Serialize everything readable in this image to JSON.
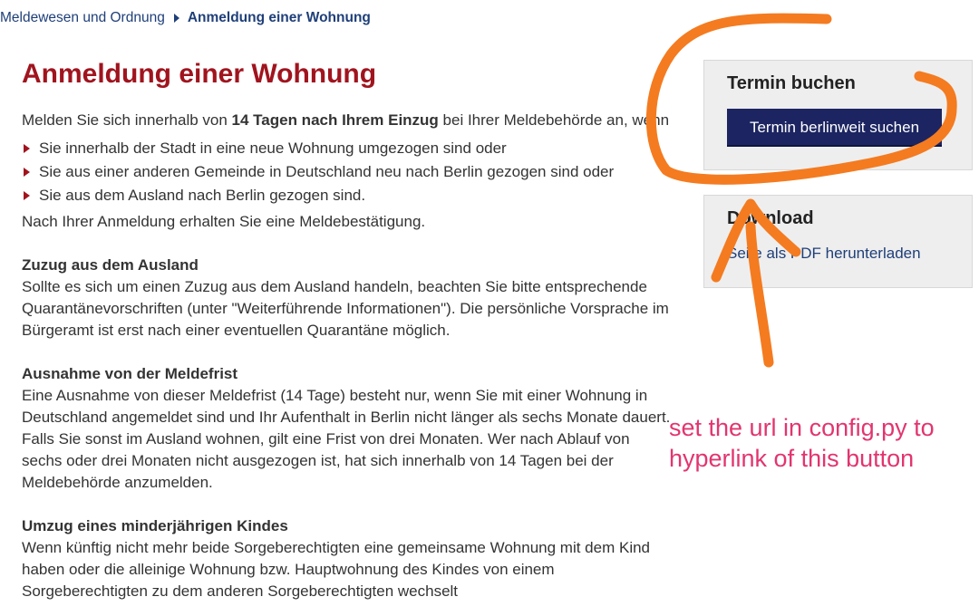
{
  "breadcrumb": {
    "parent": "Meldewesen und Ordnung",
    "current": "Anmeldung einer Wohnung"
  },
  "main": {
    "title": "Anmeldung einer Wohnung",
    "intro_before": "Melden Sie sich innerhalb von ",
    "intro_bold": "14 Tagen nach Ihrem Einzug",
    "intro_after": " bei Ihrer Meldebehörde an, wenn",
    "reasons": [
      "Sie innerhalb der Stadt in eine neue Wohnung umgezogen sind oder",
      "Sie aus einer anderen Gemeinde in Deutschland neu nach Berlin gezogen sind oder",
      "Sie aus dem Ausland nach Berlin gezogen sind."
    ],
    "confirmation": "Nach Ihrer Anmeldung erhalten Sie eine Meldebestätigung.",
    "sections": [
      {
        "heading": "Zuzug aus dem Ausland",
        "paragraphs": [
          "Sollte es sich um einen Zuzug aus dem Ausland handeln, beachten Sie bitte entsprechende Quarantänevorschriften (unter \"Weiterführende Informationen\"). Die persönliche Vorsprache im Bürgeramt ist erst nach einer eventuellen Quarantäne möglich."
        ]
      },
      {
        "heading": "Ausnahme von der Meldefrist",
        "paragraphs": [
          "Eine Ausnahme von dieser Meldefrist (14 Tage) besteht nur, wenn Sie mit einer Wohnung in Deutschland angemeldet sind und Ihr Aufenthalt in Berlin nicht länger als sechs Monate dauert.",
          "Falls Sie sonst im Ausland wohnen, gilt eine Frist von drei Monaten. Wer nach Ablauf von sechs oder drei Monaten nicht ausgezogen ist, hat sich innerhalb von 14 Tagen bei der Meldebehörde anzumelden."
        ]
      },
      {
        "heading": "Umzug eines minderjährigen Kindes",
        "paragraphs": [
          "Wenn künftig nicht mehr beide Sorgeberechtigten eine gemeinsame Wohnung mit dem Kind haben oder die alleinige Wohnung bzw. Hauptwohnung des Kindes von einem Sorgeberechtigten zu dem anderen Sorgeberechtigten wechselt"
        ]
      }
    ]
  },
  "sidebar": {
    "termin": {
      "title": "Termin buchen",
      "button_label": "Termin berlinweit suchen"
    },
    "download": {
      "title": "Download",
      "link_label": "Seite als PDF herunterladen"
    }
  },
  "annotation": {
    "text": "set the url in config.py to hyperlink of this button",
    "color": "#e2356f",
    "marker_color": "#f47b20"
  }
}
